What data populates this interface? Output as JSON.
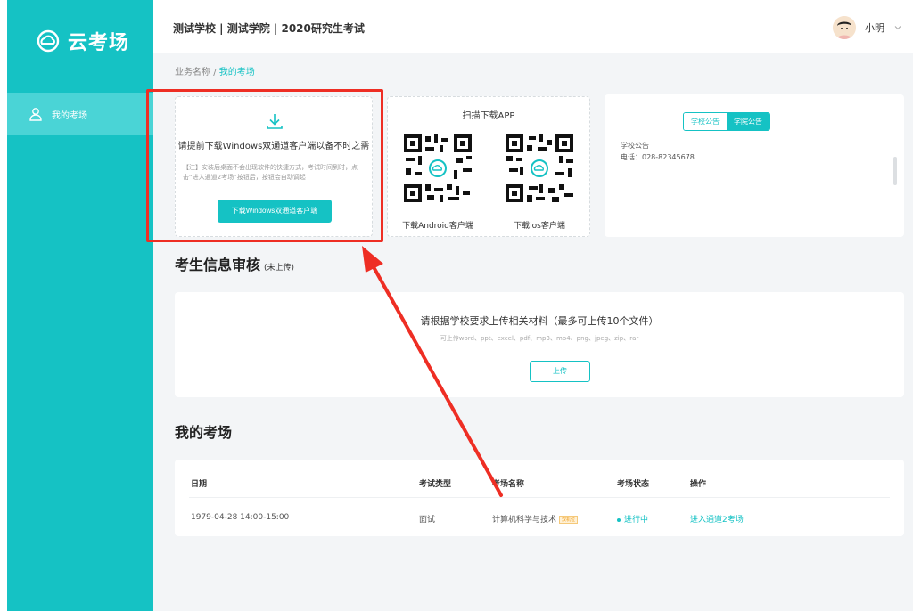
{
  "sidebar": {
    "logo_text": "云考场",
    "nav_items": [
      {
        "label": "我的考场",
        "icon": "user-icon",
        "active": true
      }
    ]
  },
  "header": {
    "title": "测试学校 | 测试学院 | 2020研究生考试",
    "user_name": "小明"
  },
  "breadcrumb": {
    "parent": "业务名称",
    "separator": "/",
    "current": "我的考场"
  },
  "download_card": {
    "title": "请提前下载Windows双通道客户端以备不时之需",
    "note": "【注】安装后桌面不会出现软件的快捷方式，考试时间到时，点击“进入通道2考场”按钮后，按钮会自动调起",
    "button_label": "下载Windows双通道客户端"
  },
  "qr_card": {
    "title": "扫描下载APP",
    "android_label": "下载Android客户端",
    "ios_label": "下载ios客户端"
  },
  "notice_card": {
    "tabs": [
      "学校公告",
      "学院公告"
    ],
    "active_tab": 1,
    "notice_title": "学校公告",
    "notice_phone": "电话：028-82345678"
  },
  "review_section": {
    "title": "考生信息审核",
    "status": "(未上传)",
    "upload_title": "请根据学校要求上传相关材料（最多可上传10个文件）",
    "upload_hint": "可上传word、ppt、excel、pdf、mp3、mp4、png、jpeg、zip、rar",
    "upload_button": "上传"
  },
  "exam_section": {
    "title": "我的考场",
    "columns": [
      "日期",
      "考试类型",
      "考场名称",
      "考场状态",
      "操作"
    ],
    "rows": [
      {
        "date": "1979-04-28 14:00-15:00",
        "type": "面试",
        "name": "计算机科学与技术",
        "tag": "双机位",
        "status": "进行中",
        "action": "进入通道2考场"
      }
    ]
  },
  "colors": {
    "brand": "#15c2c4",
    "sidebar_active": "#4ad4d6",
    "annotation": "#ee2e24"
  }
}
